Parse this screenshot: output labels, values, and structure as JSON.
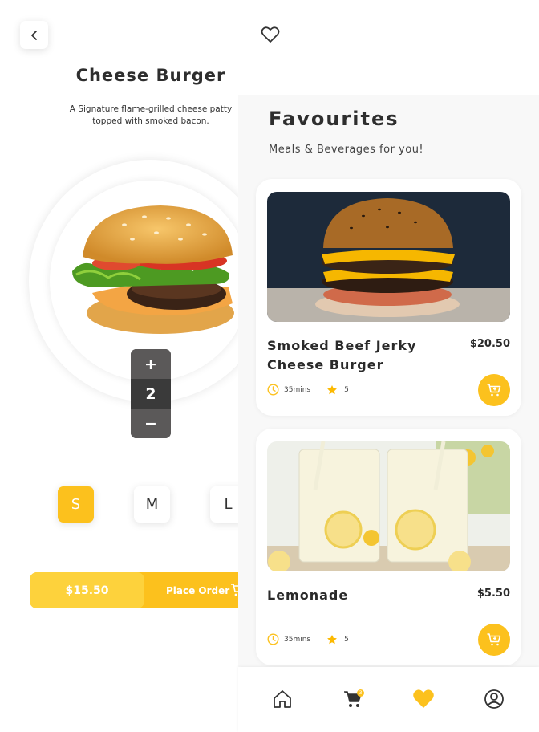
{
  "detail": {
    "title": "Cheese Burger",
    "description": "A Signature flame-grilled cheese patty topped with smoked bacon.",
    "quantity": "2",
    "plus_label": "+",
    "minus_label": "−",
    "sizes": [
      {
        "label": "S",
        "selected": true
      },
      {
        "label": "M",
        "selected": false
      },
      {
        "label": "L",
        "selected": false
      }
    ],
    "total_price": "$15.50",
    "place_order_label": "Place Order"
  },
  "favourites": {
    "title": "Favourites",
    "subtitle": "Meals & Beverages for you!",
    "items": [
      {
        "name": "Smoked Beef Jerky Cheese Burger",
        "price": "$20.50",
        "time": "35mins",
        "rating": "5",
        "image": "double-cheeseburger-photo"
      },
      {
        "name": "Lemonade",
        "price": "$5.50",
        "time": "35mins",
        "rating": "5",
        "image": "lemonade-glasses-photo"
      }
    ]
  },
  "nav": {
    "items": [
      "home-icon",
      "cart-icon",
      "heart-icon",
      "profile-icon"
    ],
    "active": "heart-icon",
    "cart_badge": "3"
  },
  "colors": {
    "accent": "#fcc11d",
    "accent_light": "#fdd23c",
    "dark": "#3a3a3a",
    "text": "#2b2b2b"
  }
}
